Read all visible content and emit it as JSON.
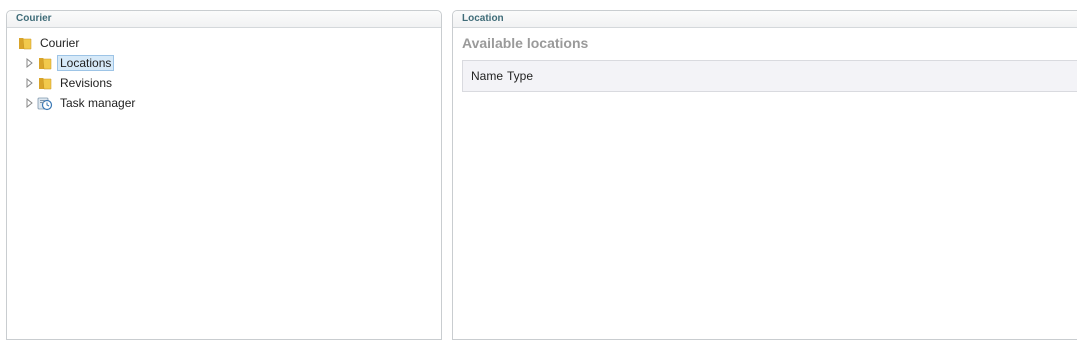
{
  "left_panel": {
    "title": "Courier",
    "tree": {
      "root_label": "Courier",
      "items": [
        {
          "label": "Locations",
          "icon": "folder-icon",
          "selected": true
        },
        {
          "label": "Revisions",
          "icon": "folder-icon",
          "selected": false
        },
        {
          "label": "Task manager",
          "icon": "task-manager-icon",
          "selected": false
        }
      ]
    }
  },
  "right_panel": {
    "title": "Location",
    "section_title": "Available locations",
    "table": {
      "columns": [
        "Name",
        "Type"
      ]
    }
  },
  "colors": {
    "header_text": "#3f6c78",
    "selected_bg": "#d6e9f8",
    "folder": "#e8b83a"
  }
}
